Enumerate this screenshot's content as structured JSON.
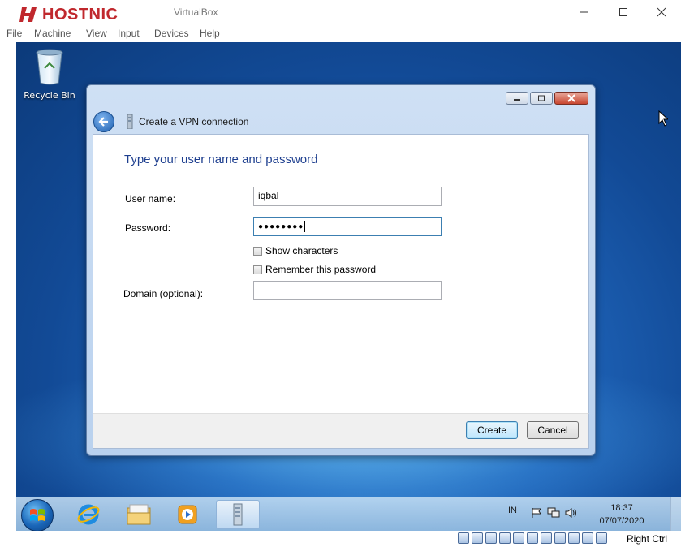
{
  "host": {
    "brand": "HOSTNIC",
    "title": "VirtualBox",
    "menu": [
      {
        "label": "File"
      },
      {
        "label": "Machine"
      },
      {
        "label": "View"
      },
      {
        "label": "Input"
      },
      {
        "label": "Devices"
      },
      {
        "label": "Help"
      }
    ],
    "status_right_text": "Right Ctrl"
  },
  "desktop": {
    "icons": [
      {
        "label": "Recycle Bin",
        "icon": "recycle-bin-icon"
      }
    ]
  },
  "dialog": {
    "title": "Create a VPN connection",
    "heading": "Type your user name and password",
    "fields": {
      "username": {
        "label": "User name:",
        "value": "iqbal"
      },
      "password": {
        "label": "Password:",
        "value": "●●●●●●●●"
      },
      "domain": {
        "label": "Domain (optional):",
        "value": ""
      }
    },
    "checkboxes": {
      "show_characters": {
        "label": "Show characters",
        "checked": false
      },
      "remember_password": {
        "label": "Remember this password",
        "checked": false
      }
    },
    "buttons": {
      "create": "Create",
      "cancel": "Cancel"
    }
  },
  "taskbar": {
    "items": [
      "start-orb-icon",
      "internet-explorer-icon",
      "file-explorer-icon",
      "media-player-icon",
      "network-connections-icon"
    ],
    "tray": {
      "language": "IN",
      "time": "18:37",
      "date": "07/07/2020"
    }
  },
  "colors": {
    "accent_heading": "#1e3f8f",
    "brand_red": "#c0282d",
    "desktop_blue": "#1e63b8"
  }
}
